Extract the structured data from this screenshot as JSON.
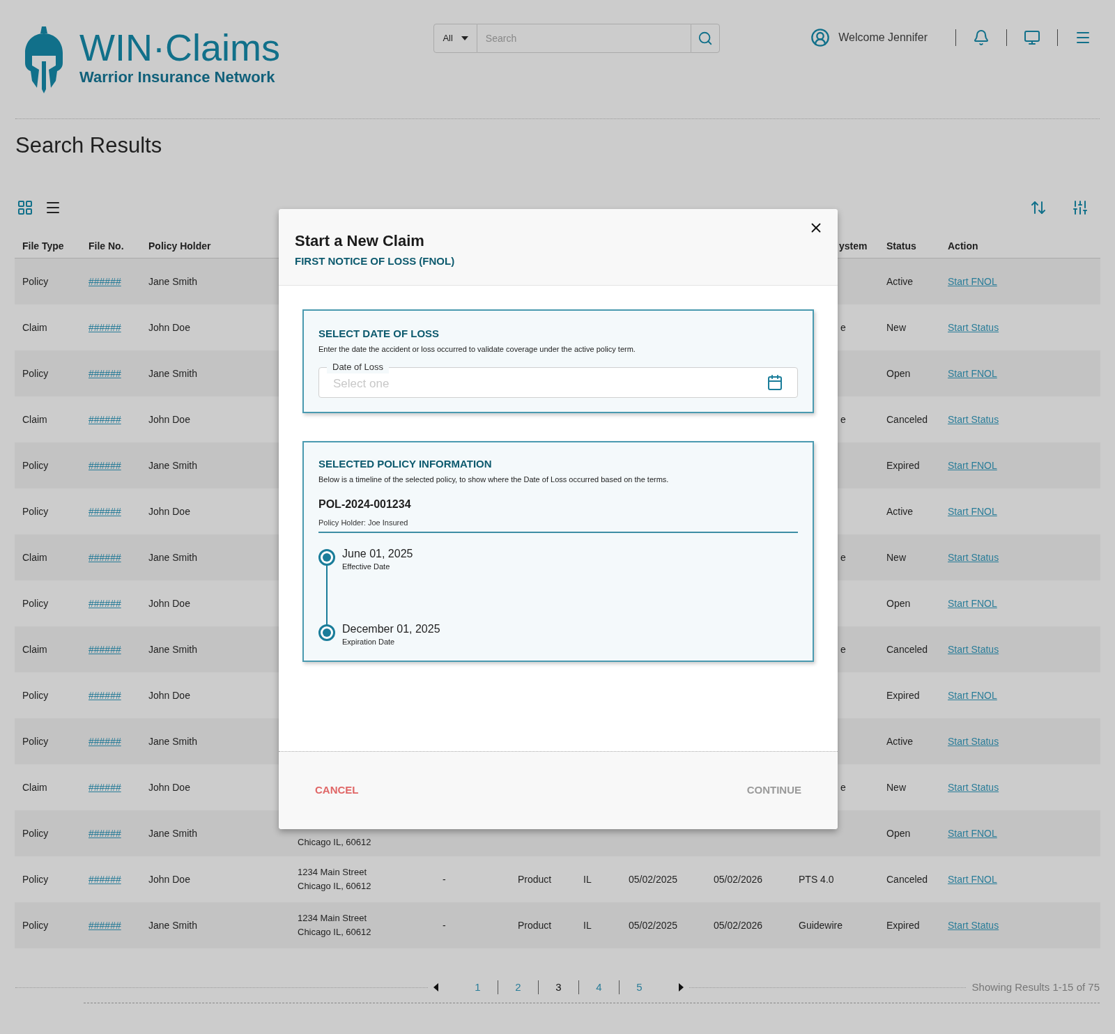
{
  "header": {
    "logo": {
      "title": "WIN·Claims",
      "subtitle": "Warrior Insurance Network"
    },
    "search": {
      "scope": "All",
      "placeholder": "Search"
    },
    "welcome": "Welcome Jennifer"
  },
  "page_title": "Search Results",
  "view_modes": [
    {
      "kind": "grid",
      "selected": true
    },
    {
      "kind": "list",
      "selected": false
    }
  ],
  "table": {
    "columns": [
      {
        "label": "File Type"
      },
      {
        "label": "File No."
      },
      {
        "label": "Policy Holder"
      },
      {
        "fragment": "ystem"
      },
      {
        "label": "Status"
      },
      {
        "label": "Action"
      }
    ],
    "rows": [
      {
        "file_type": "Policy",
        "file_no": "######",
        "policy_holder": "Jane Smith",
        "status": "Active",
        "action": "Start FNOL"
      },
      {
        "file_type": "Claim",
        "file_no": "######",
        "policy_holder": "John Doe",
        "system_fragment": "e",
        "status": "New",
        "action": "Start Status"
      },
      {
        "file_type": "Policy",
        "file_no": "######",
        "policy_holder": "Jane Smith",
        "status": "Open",
        "action": "Start FNOL"
      },
      {
        "file_type": "Claim",
        "file_no": "######",
        "policy_holder": "John Doe",
        "system_fragment": "e",
        "status": "Canceled",
        "action": "Start Status"
      },
      {
        "file_type": "Policy",
        "file_no": "######",
        "policy_holder": "Jane Smith",
        "status": "Expired",
        "action": "Start FNOL"
      },
      {
        "file_type": "Policy",
        "file_no": "######",
        "policy_holder": "John Doe",
        "status": "Active",
        "action": "Start FNOL"
      },
      {
        "file_type": "Claim",
        "file_no": "######",
        "policy_holder": "Jane Smith",
        "system_fragment": "e",
        "status": "New",
        "action": "Start Status"
      },
      {
        "file_type": "Policy",
        "file_no": "######",
        "policy_holder": "John Doe",
        "status": "Open",
        "action": "Start FNOL"
      },
      {
        "file_type": "Claim",
        "file_no": "######",
        "policy_holder": "Jane Smith",
        "system_fragment": "e",
        "status": "Canceled",
        "action": "Start Status"
      },
      {
        "file_type": "Policy",
        "file_no": "######",
        "policy_holder": "John Doe",
        "status": "Expired",
        "action": "Start FNOL"
      },
      {
        "file_type": "Policy",
        "file_no": "######",
        "policy_holder": "Jane Smith",
        "status": "Active",
        "action": "Start Status"
      },
      {
        "file_type": "Claim",
        "file_no": "######",
        "policy_holder": "John Doe",
        "system_fragment": "e",
        "status": "New",
        "action": "Start Status"
      },
      {
        "file_type": "Policy",
        "file_no": "######",
        "policy_holder": "Jane Smith",
        "address_fragment": "Chicago IL, 60612",
        "status": "Open",
        "action": "Start FNOL"
      },
      {
        "file_type": "Policy",
        "file_no": "######",
        "policy_holder": "John Doe",
        "address": [
          "1234 Main Street",
          "Chicago IL, 60612"
        ],
        "column_5": "-",
        "product": "Product",
        "state": "IL",
        "date_1": "05/02/2025",
        "date_2": "05/02/2026",
        "system": "PTS 4.0",
        "status": "Canceled",
        "action": "Start FNOL"
      },
      {
        "file_type": "Policy",
        "file_no": "######",
        "policy_holder": "Jane Smith",
        "address": [
          "1234 Main Street",
          "Chicago IL, 60612"
        ],
        "column_5": "-",
        "product": "Product",
        "state": "IL",
        "date_1": "05/02/2025",
        "date_2": "05/02/2026",
        "system": "Guidewire",
        "status": "Expired",
        "action": "Start Status"
      }
    ]
  },
  "pagination": {
    "pages": [
      {
        "label": "1",
        "selected": false
      },
      {
        "label": "2",
        "selected": false
      },
      {
        "label": "3",
        "selected": true
      },
      {
        "label": "4",
        "selected": false
      },
      {
        "label": "5",
        "selected": false
      }
    ],
    "summary": "Showing Results 1-15 of 75"
  },
  "modal": {
    "title": "Start a New Claim",
    "subtitle": "FIRST NOTICE OF LOSS (FNOL)",
    "date_section": {
      "heading": "SELECT DATE OF LOSS",
      "description": "Enter the date the accident or loss occurred to validate coverage under the active policy term.",
      "field_label": "Date of Loss",
      "placeholder": "Select one"
    },
    "policy_section": {
      "heading": "SELECTED POLICY INFORMATION",
      "description": "Below is a timeline of the selected policy, to show where the Date of Loss occurred based on the terms.",
      "policy_number": "POL-2024-001234",
      "policy_holder": "Policy Holder: Joe Insured",
      "timeline": [
        {
          "date": "June 01, 2025",
          "label": "Effective Date"
        },
        {
          "date": "December 01, 2025",
          "label": "Expiration Date"
        }
      ]
    },
    "cancel": "CANCEL",
    "continue": "CONTINUE"
  }
}
